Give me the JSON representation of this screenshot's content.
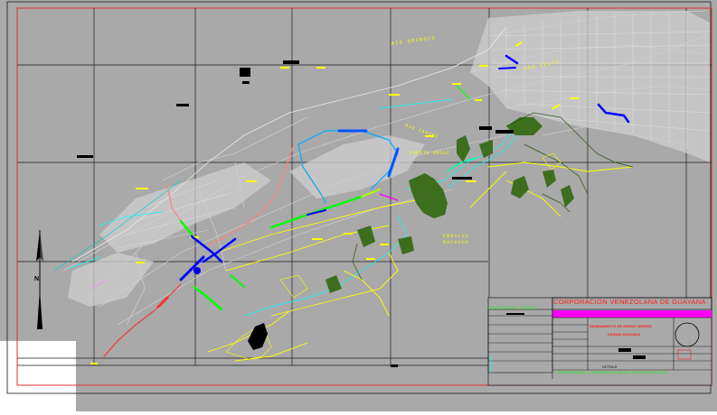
{
  "drawing": {
    "labels": {
      "rio_orinoco": "RIO ORINOCO",
      "san_felix": "SAN FELIX",
      "rio_caroni": "RIO CARONI",
      "puerto_ordaz": "PUERTO ORDAZ",
      "embalse_macagua": "EMBALSE MACAGUA"
    }
  },
  "title_block": {
    "organization": "CORPORACION VENEZOLANA DE GUAYANA",
    "project": "SANEAMIENTO DE AREAS VERDES",
    "city": "CIUDAD GUAYANA",
    "observations_header": "OBSERVACIONES",
    "sheet_number": "UCT04-5",
    "footer": "VICEPRESIDENCIA CORPORATIVA DE OBRAS Y SERVICIOS PUBLICOS"
  },
  "north_arrow": {
    "letter": "N"
  },
  "colors": {
    "canvas": "#a9a9a9",
    "frame": "#e03030",
    "grid": "#1a1a1a",
    "river_label": "#ffff00",
    "streets": "#d8d8d8",
    "green_areas": "#3c6e1e",
    "title_text": "#ff2020",
    "title_bar": "#ff00ff",
    "footer_text": "#00ff00"
  }
}
